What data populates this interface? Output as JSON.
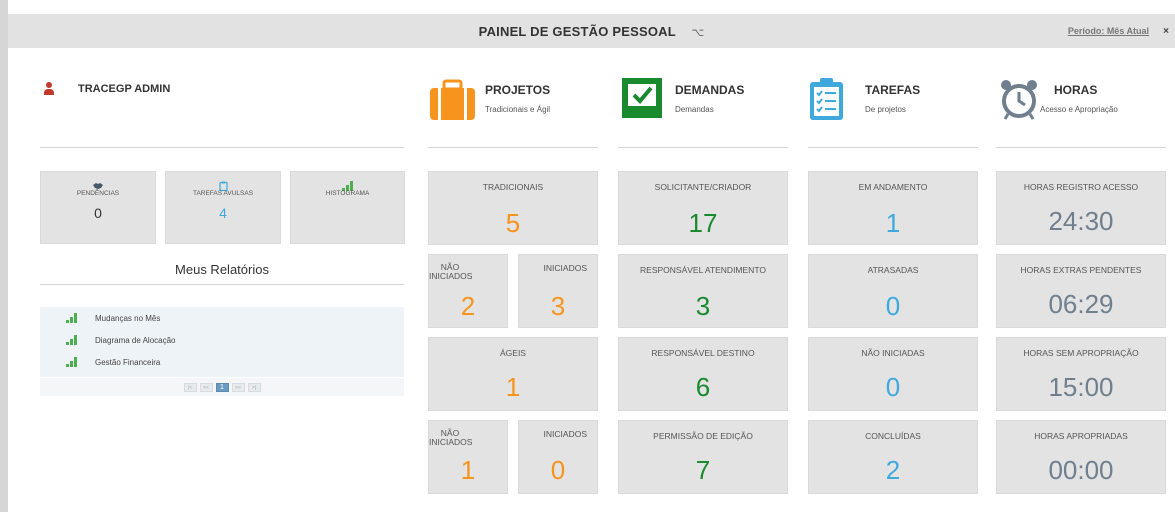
{
  "header": {
    "title": "PAINEL DE GESTÃO PESSOAL",
    "refresh_icon": "⌥",
    "period": "Período: Mês Atual",
    "close": "×"
  },
  "user": {
    "name": "TRACEGP ADMIN"
  },
  "quick": [
    {
      "label": "PENDÊNCIAS",
      "value": "0",
      "icon": "handshake-icon"
    },
    {
      "label": "TAREFAS AVULSAS",
      "value": "4",
      "icon": "clipboard-icon"
    },
    {
      "label": "HISTOGRAMA",
      "value": "",
      "icon": "bar-chart-icon"
    }
  ],
  "reports": {
    "title": "Meus Relatórios",
    "items": [
      "Mudanças no Mês",
      "Diagrama de Alocação",
      "Gestão Financeira"
    ],
    "pager": [
      "|<",
      "<<",
      "1",
      ">>",
      ">|"
    ]
  },
  "sections": [
    {
      "title": "PROJETOS",
      "subtitle": "Tradicionais e Ágil",
      "icon": "briefcase-icon"
    },
    {
      "title": "DEMANDAS",
      "subtitle": "Demandas",
      "icon": "checkbox-icon"
    },
    {
      "title": "TAREFAS",
      "subtitle": "De projetos",
      "icon": "task-clipboard-icon"
    },
    {
      "title": "HORAS",
      "subtitle": "Acesso e Apropriação",
      "icon": "alarm-clock-icon"
    }
  ],
  "projetos": {
    "tradicionais": {
      "label": "TRADICIONAIS",
      "value": "5"
    },
    "trad_nao_iniciados": {
      "label": "NÃO INICIADOS",
      "value": "2"
    },
    "trad_iniciados": {
      "label": "INICIADOS",
      "value": "3"
    },
    "ageis": {
      "label": "ÁGEIS",
      "value": "1"
    },
    "ageis_nao_iniciados": {
      "label": "NÃO INICIADOS",
      "value": "1"
    },
    "ageis_iniciados": {
      "label": "INICIADOS",
      "value": "0"
    }
  },
  "demandas": [
    {
      "label": "SOLICITANTE/CRIADOR",
      "value": "17"
    },
    {
      "label": "RESPONSÁVEL ATENDIMENTO",
      "value": "3"
    },
    {
      "label": "RESPONSÁVEL DESTINO",
      "value": "6"
    },
    {
      "label": "PERMISSÃO DE EDIÇÃO",
      "value": "7"
    }
  ],
  "tarefas": [
    {
      "label": "EM ANDAMENTO",
      "value": "1"
    },
    {
      "label": "ATRASADAS",
      "value": "0"
    },
    {
      "label": "NÃO INICIADAS",
      "value": "0"
    },
    {
      "label": "CONCLUÍDAS",
      "value": "2"
    }
  ],
  "horas": [
    {
      "label": "HORAS REGISTRO ACESSO",
      "value": "24:30"
    },
    {
      "label": "HORAS EXTRAS PENDENTES",
      "value": "06:29"
    },
    {
      "label": "HORAS SEM APROPRIAÇÃO",
      "value": "15:00"
    },
    {
      "label": "HORAS APROPRIADAS",
      "value": "00:00"
    }
  ],
  "colors": {
    "orange": "#f7941d",
    "green": "#1a8a2e",
    "blue": "#3fa9dd",
    "slate": "#6f7f8e",
    "dark": "#333333",
    "user_red": "#c0392b"
  }
}
